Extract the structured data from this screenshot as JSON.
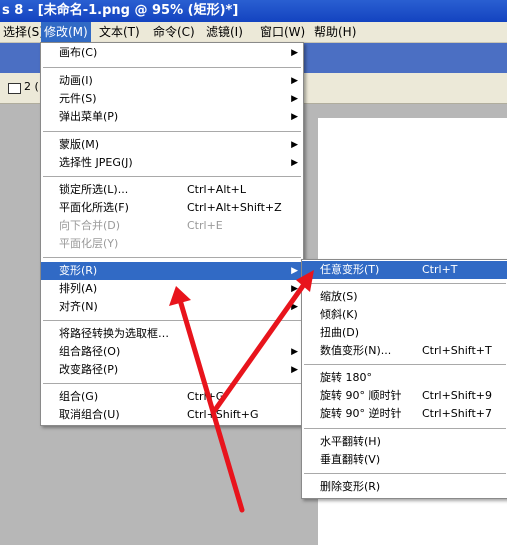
{
  "title": "s 8 - [未命名-1.png @ 95% (矩形)*]",
  "menubar": [
    {
      "label": "选择(S)",
      "active": false
    },
    {
      "label": "修改(M)",
      "active": true
    },
    {
      "label": "文本(T)",
      "active": false
    },
    {
      "label": "命令(C)",
      "active": false
    },
    {
      "label": "滤镜(I)",
      "active": false
    },
    {
      "label": "窗口(W)",
      "active": false
    },
    {
      "label": "帮助(H)",
      "active": false
    }
  ],
  "toolbar": {
    "text": "2 ("
  },
  "modify_menu": {
    "items": [
      {
        "label": "画布(C)",
        "shortcut": "",
        "submenu": true
      },
      {
        "label": "动画(I)",
        "shortcut": "",
        "submenu": true
      },
      {
        "label": "元件(S)",
        "shortcut": "",
        "submenu": true
      },
      {
        "label": "弹出菜单(P)",
        "shortcut": "",
        "submenu": true
      },
      {
        "label": "蒙版(M)",
        "shortcut": "",
        "submenu": true
      },
      {
        "label": "选择性 JPEG(J)",
        "shortcut": "",
        "submenu": true
      },
      {
        "label": "锁定所选(L)...",
        "shortcut": "Ctrl+Alt+L",
        "submenu": false
      },
      {
        "label": "平面化所选(F)",
        "shortcut": "Ctrl+Alt+Shift+Z",
        "submenu": false
      },
      {
        "label": "向下合并(D)",
        "shortcut": "Ctrl+E",
        "submenu": false,
        "disabled": true
      },
      {
        "label": "平面化层(Y)",
        "shortcut": "",
        "submenu": false,
        "disabled": true
      },
      {
        "label": "变形(R)",
        "shortcut": "",
        "submenu": true,
        "highlighted": true
      },
      {
        "label": "排列(A)",
        "shortcut": "",
        "submenu": true
      },
      {
        "label": "对齐(N)",
        "shortcut": "",
        "submenu": true
      },
      {
        "label": "将路径转换为选取框…",
        "shortcut": "",
        "submenu": false
      },
      {
        "label": "组合路径(O)",
        "shortcut": "",
        "submenu": true
      },
      {
        "label": "改变路径(P)",
        "shortcut": "",
        "submenu": true
      },
      {
        "label": "组合(G)",
        "shortcut": "Ctrl+G",
        "submenu": false
      },
      {
        "label": "取消组合(U)",
        "shortcut": "Ctrl+Shift+G",
        "submenu": false
      }
    ]
  },
  "transform_submenu": {
    "items": [
      {
        "label": "任意变形(T)",
        "shortcut": "Ctrl+T",
        "highlighted": true
      },
      {
        "label": "缩放(S)",
        "shortcut": ""
      },
      {
        "label": "倾斜(K)",
        "shortcut": ""
      },
      {
        "label": "扭曲(D)",
        "shortcut": ""
      },
      {
        "label": "数值变形(N)...",
        "shortcut": "Ctrl+Shift+T"
      },
      {
        "label": "旋转 180°",
        "shortcut": ""
      },
      {
        "label": "旋转 90° 顺时针",
        "shortcut": "Ctrl+Shift+9"
      },
      {
        "label": "旋转 90° 逆时针",
        "shortcut": "Ctrl+Shift+7"
      },
      {
        "label": "水平翻转(H)",
        "shortcut": ""
      },
      {
        "label": "垂直翻转(V)",
        "shortcut": ""
      },
      {
        "label": "删除变形(R)",
        "shortcut": ""
      }
    ]
  },
  "colors": {
    "highlight": "#316ac5",
    "annotation_arrow": "#e8141c",
    "titlebar": "#1f4fc9"
  }
}
